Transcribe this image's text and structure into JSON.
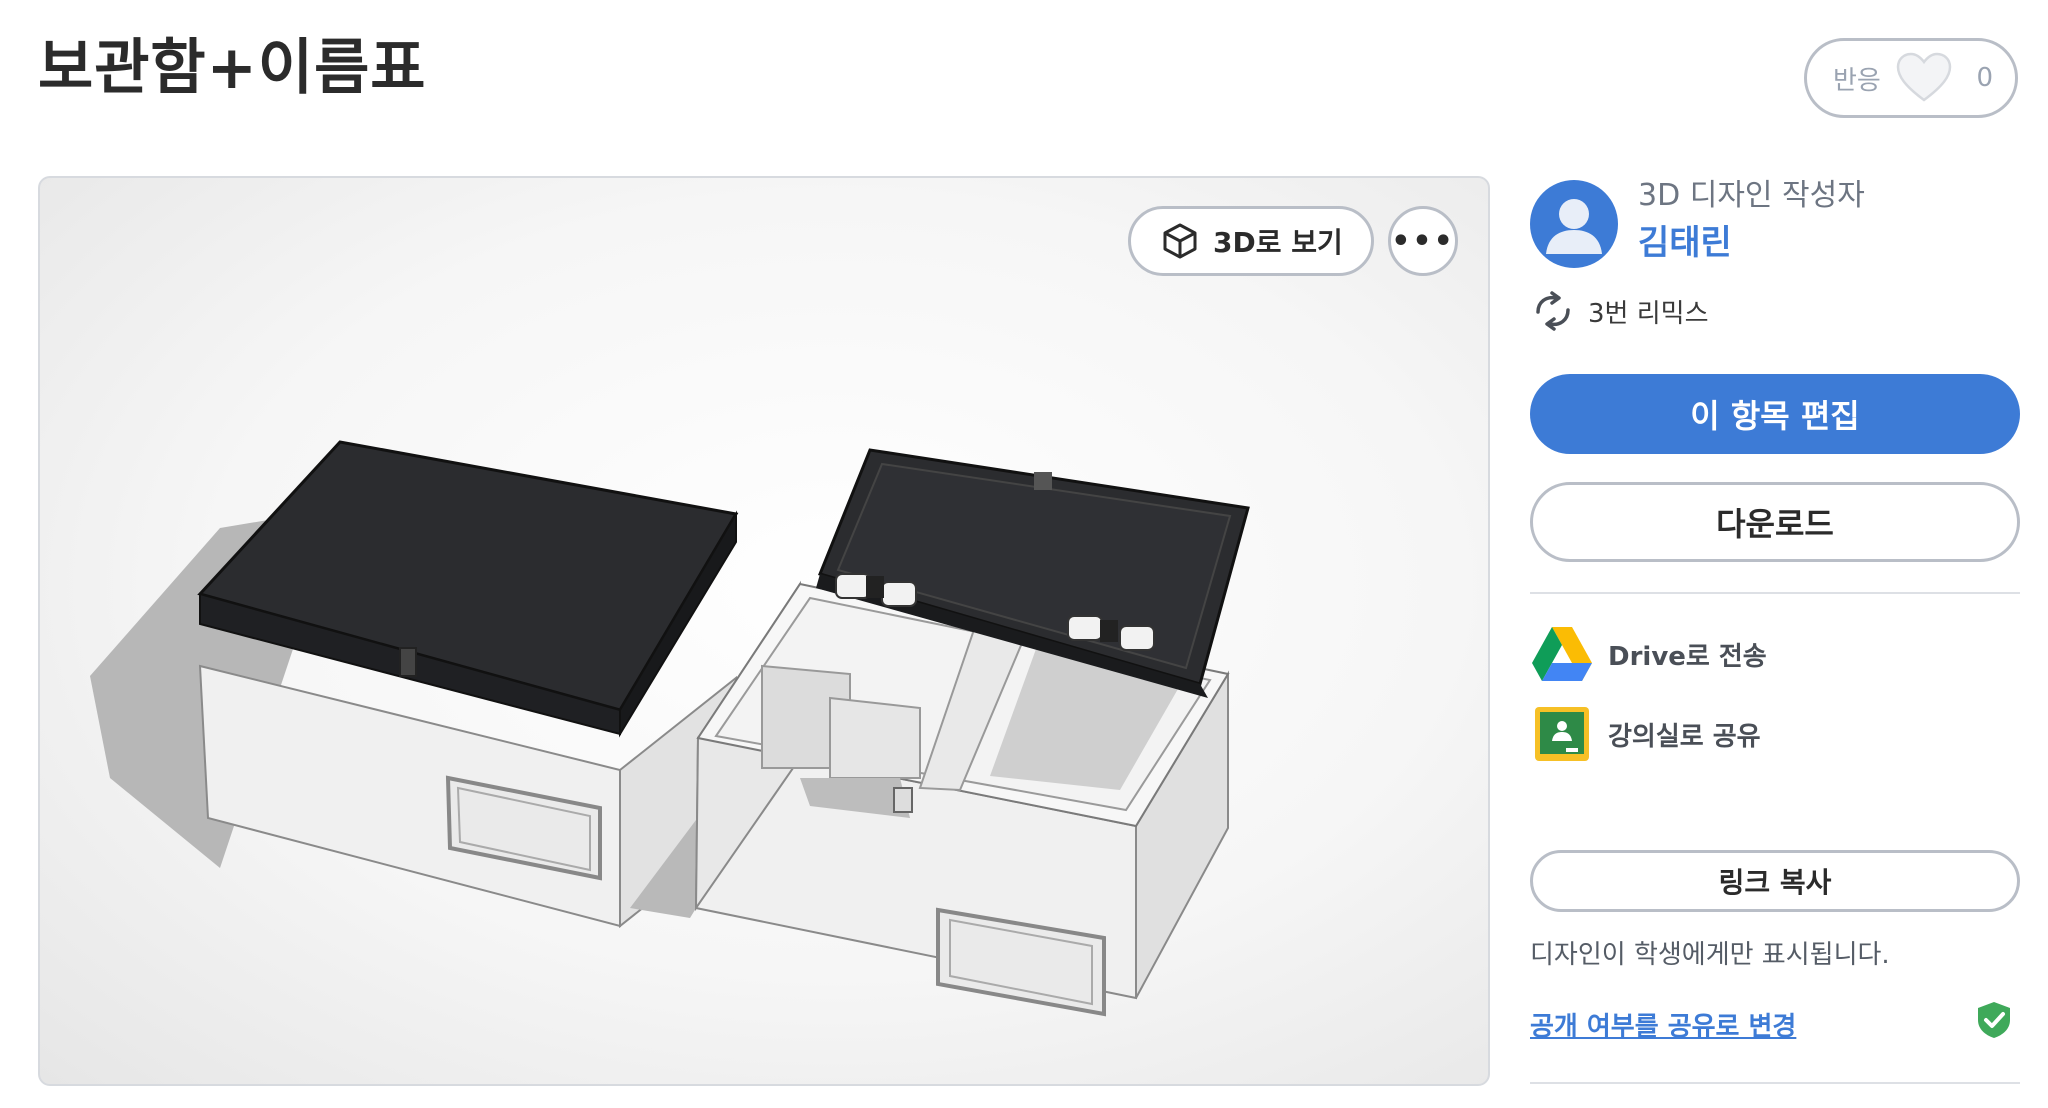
{
  "page": {
    "title": "보관함+이름표"
  },
  "reactions": {
    "label": "반응",
    "count": "0",
    "icon": "heart-icon"
  },
  "viewer": {
    "view_3d_label": "3D로 보기",
    "view_3d_icon": "cube-icon",
    "more_icon": "more-dots-icon",
    "more_glyph": "•••"
  },
  "author": {
    "role": "3D 디자인 작성자",
    "name": "김태린"
  },
  "remix": {
    "text": "3번 리믹스",
    "icon": "remix-icon"
  },
  "actions": {
    "edit_label": "이 항목 편집",
    "download_label": "다운로드"
  },
  "share": {
    "drive_label": "Drive로 전송",
    "classroom_label": "강의실로 공유",
    "copy_link_label": "링크 복사",
    "visibility_note": "디자인이 학생에게만 표시됩니다.",
    "change_visibility_link": "공개 여부를 공유로 변경"
  },
  "colors": {
    "accent": "#3d7bd6",
    "shield": "#3fa95a"
  }
}
